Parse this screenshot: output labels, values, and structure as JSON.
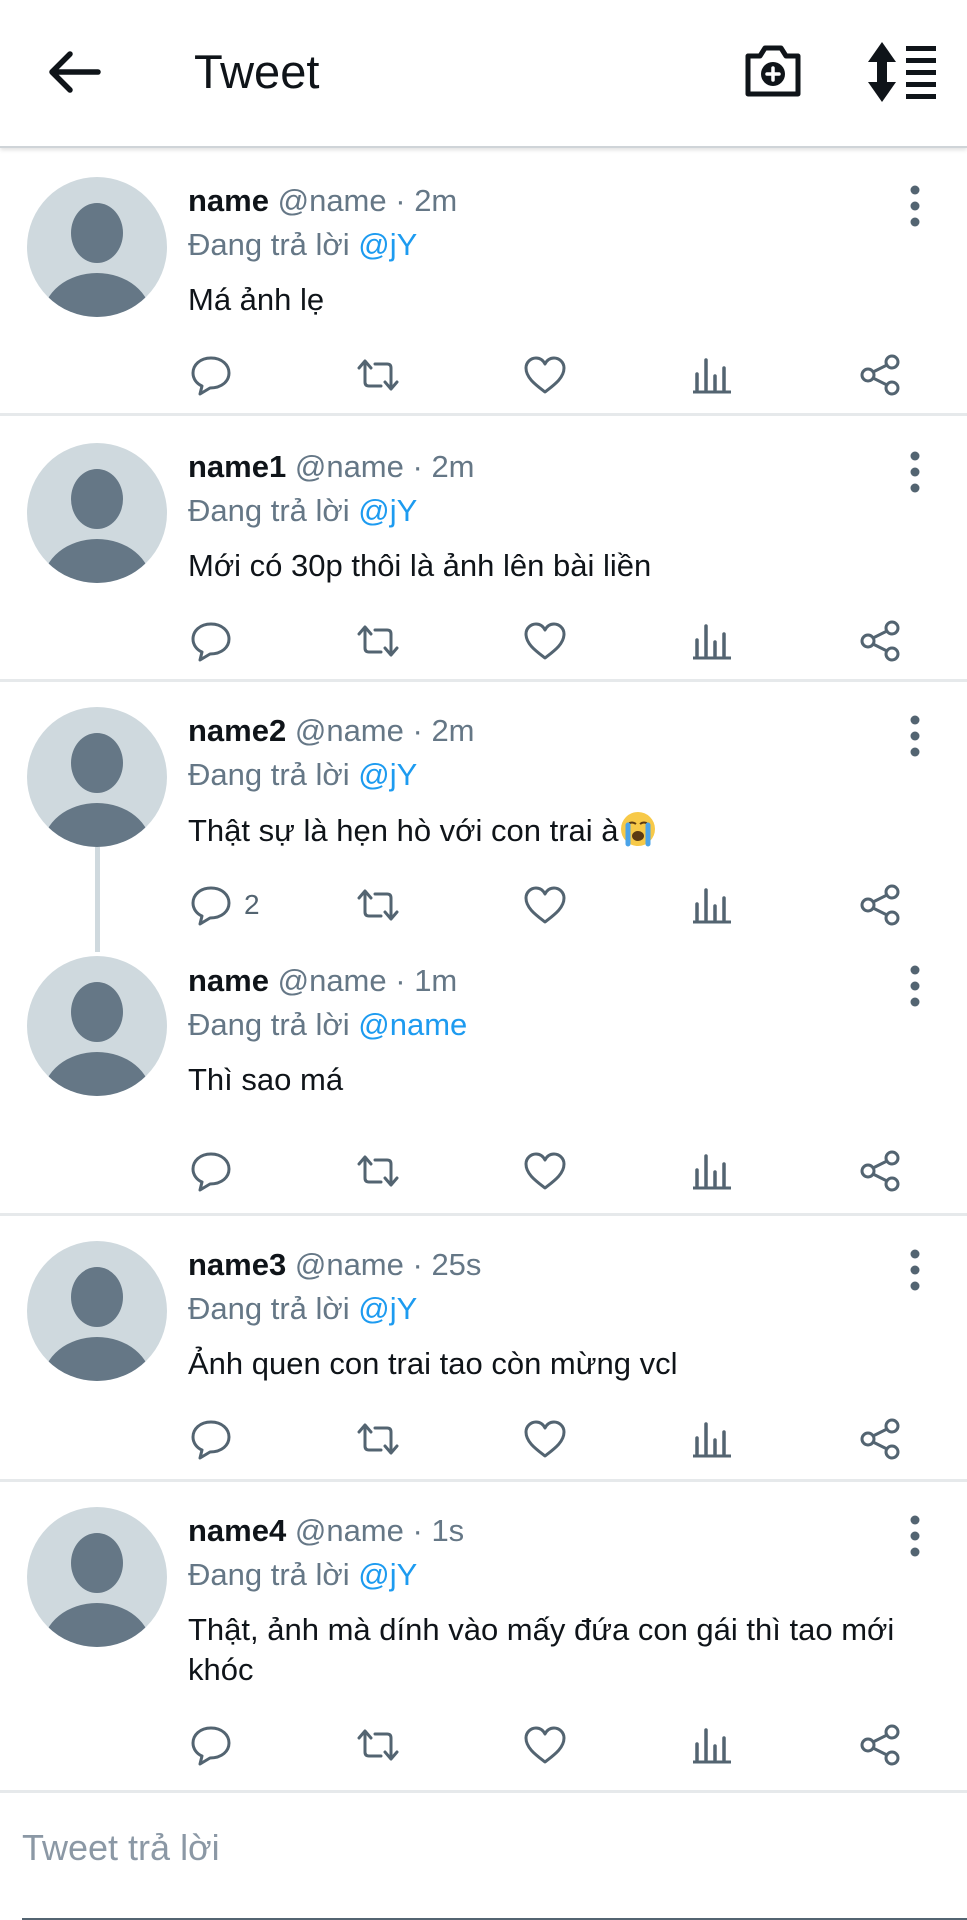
{
  "header": {
    "title": "Tweet",
    "back_icon": "arrow-left-icon",
    "camera_icon": "camera-add-icon",
    "sort_icon": "sort-list-icon"
  },
  "colors": {
    "mention": "#1d9bf0",
    "meta": "#657786",
    "avatar_bg": "#cfd9de",
    "avatar_fg": "#657786",
    "icon": "#536471"
  },
  "tweets": [
    {
      "name": "name",
      "handle": "@name",
      "time": "2m",
      "reply_prefix": "Đang trả lời",
      "reply_to": "@jY",
      "text": "Má ảnh lẹ",
      "reply_count": ""
    },
    {
      "name": "name1",
      "handle": "@name",
      "time": "2m",
      "reply_prefix": "Đang trả lời",
      "reply_to": "@jY",
      "text": "Mới có 30p thôi là ảnh lên bài liền",
      "reply_count": ""
    },
    {
      "name": "name2",
      "handle": "@name",
      "time": "2m",
      "reply_prefix": "Đang trả lời",
      "reply_to": "@jY",
      "text": "Thật sự là hẹn hò với con trai à",
      "emoji": "loudly-crying-face",
      "reply_count": "2"
    },
    {
      "name": "name",
      "handle": "@name",
      "time": "1m",
      "reply_prefix": "Đang trả lời",
      "reply_to": "@name",
      "text": "Thì sao má",
      "reply_count": ""
    },
    {
      "name": "name3",
      "handle": "@name",
      "time": "25s",
      "reply_prefix": "Đang trả lời",
      "reply_to": "@jY",
      "text": "Ảnh quen con trai tao còn mừng vcl",
      "reply_count": ""
    },
    {
      "name": "name4",
      "handle": "@name",
      "time": "1s",
      "reply_prefix": "Đang trả lời",
      "reply_to": "@jY",
      "text": "Thật, ảnh mà dính vào mấy đứa con gái thì tao mới khóc",
      "reply_count": ""
    }
  ],
  "action_icons": [
    "reply-icon",
    "retweet-icon",
    "like-icon",
    "analytics-icon",
    "share-icon"
  ],
  "compose": {
    "placeholder": "Tweet trả lời"
  }
}
